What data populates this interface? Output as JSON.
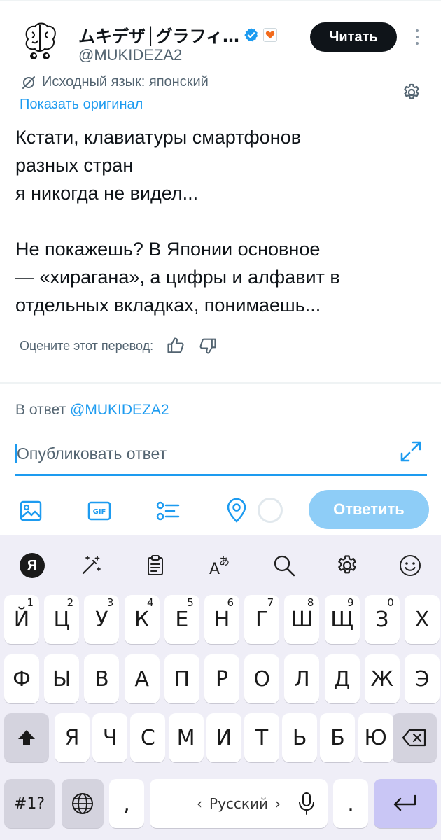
{
  "tweet": {
    "display_name": "ムキデザ│グラフィ…",
    "handle": "@MUKIDEZA2",
    "follow_label": "Читать",
    "source_language": "Исходный язык: японский",
    "show_original": "Показать оригинал",
    "text": "Кстати, клавиатуры смартфонов\nразных стран\nя никогда не видел...\n\nНе покажешь? В Японии основное\n— «хирагана», а цифры и алфавит в\nотдельных вкладках, понимаешь...",
    "rate_label": "Оцените этот перевод:"
  },
  "reply": {
    "prefix": "В ответ",
    "to_handle": "@MUKIDEZA2",
    "placeholder": "Опубликовать ответ",
    "submit_label": "Ответить"
  },
  "keyboard": {
    "row1": [
      {
        "l": "Й",
        "h": "1"
      },
      {
        "l": "Ц",
        "h": "2"
      },
      {
        "l": "У",
        "h": "3"
      },
      {
        "l": "К",
        "h": "4"
      },
      {
        "l": "Е",
        "h": "5"
      },
      {
        "l": "Н",
        "h": "6"
      },
      {
        "l": "Г",
        "h": "7"
      },
      {
        "l": "Ш",
        "h": "8"
      },
      {
        "l": "Щ",
        "h": "9"
      },
      {
        "l": "З",
        "h": "0"
      },
      {
        "l": "Х",
        "h": ""
      }
    ],
    "row2": [
      "Ф",
      "Ы",
      "В",
      "А",
      "П",
      "Р",
      "О",
      "Л",
      "Д",
      "Ж",
      "Э"
    ],
    "row3": [
      "Я",
      "Ч",
      "С",
      "М",
      "И",
      "Т",
      "Ь",
      "Б",
      "Ю"
    ],
    "symbols_label": "#1?",
    "comma": ",",
    "period": ".",
    "space_label": "Русский",
    "space_left": "‹",
    "space_right": "›"
  },
  "colors": {
    "accent": "#1d9bf0",
    "reply_button": "#8ecdf7",
    "keyboard_bg": "#efeef7"
  }
}
